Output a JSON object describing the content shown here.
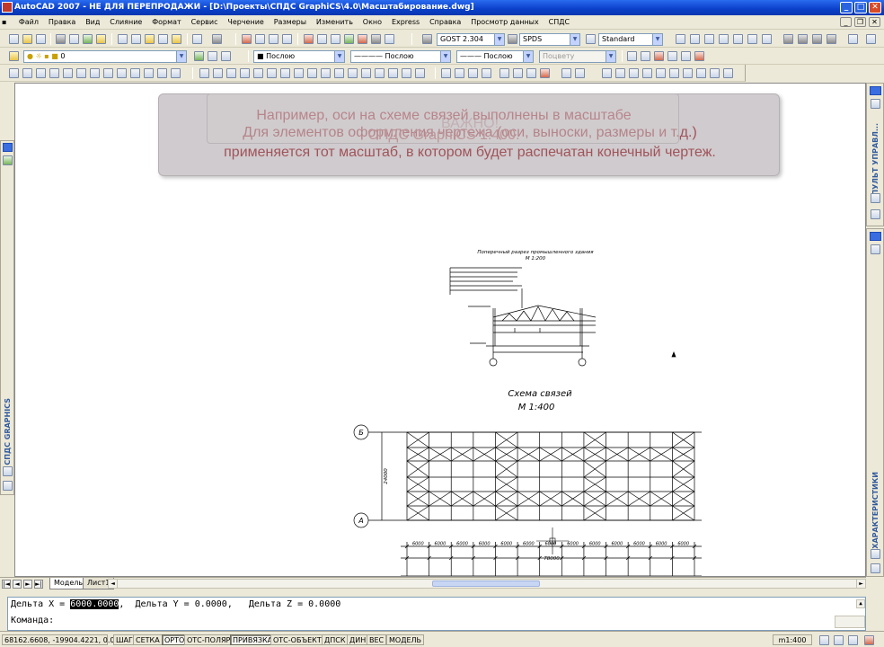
{
  "window": {
    "title": "AutoCAD 2007 - НЕ ДЛЯ ПЕРЕПРОДАЖИ - [D:\\Проекты\\СПДС GraphiCS\\4.0\\Масштабирование.dwg]"
  },
  "menu": [
    "Файл",
    "Правка",
    "Вид",
    "Слияние",
    "Формат",
    "Сервис",
    "Черчение",
    "Размеры",
    "Изменить",
    "Окно",
    "Express",
    "Справка",
    "Просмотр данных",
    "СПДС"
  ],
  "toolbar": {
    "textstyle": "GOST 2.304",
    "dimstyle": "SPDS",
    "tablestyle": "Standard",
    "layer": "0",
    "color": "Послою",
    "linetype": "Послою",
    "lineweight": "Послою",
    "plotstyle": "Поцвету"
  },
  "overlay": {
    "back_title": "ВАЖНО!",
    "back_line1": "Например, оси на схеме связей выполнены в масштабе",
    "back_line2": "СПДС GraphiCS 1:400.",
    "front_line1": "Для элементов оформления чертежа (оси, выноски, размеры и т.д.)",
    "front_line2": "применяется тот масштаб, в котором будет распечатан конечный чертеж."
  },
  "drawing": {
    "section_title": "Поперечный разрез промышленного здания",
    "section_scale": "М 1:200",
    "scheme_title": "Схема связей",
    "scheme_scale": "М 1:400",
    "axis_b": "Б",
    "axis_a": "А",
    "height_dim": "24000",
    "bay_dims": [
      "6000",
      "6000",
      "6000",
      "6000",
      "6000",
      "6000",
      "6000",
      "6000",
      "6000",
      "6000",
      "6000",
      "6000",
      "6000"
    ],
    "total_dim": "78000"
  },
  "panels": {
    "right_top": "ПУЛЬТ УПРАВЛ...",
    "right_bottom": "ХАРАКТЕРИСТИКИ",
    "left": "СПДС GRAPHICS"
  },
  "tabs": [
    "Модель",
    "Лист1"
  ],
  "command": {
    "line1_a": "Дельта X = ",
    "line1_value": "6000.0000",
    "line1_b": ",  Дельта Y = 0.0000,   Дельта Z = 0.0000",
    "prompt": "Команда:"
  },
  "status": {
    "coords": "68162.6608, -19904.4221, 0.0000",
    "buttons": [
      "ШАГ",
      "СЕТКА",
      "ОРТО",
      "ОТС-ПОЛЯР",
      "ПРИВЯЗКА",
      "ОТС-ОБЪЕКТ",
      "ДПСК",
      "ДИН",
      "ВЕС",
      "МОДЕЛЬ"
    ],
    "scale": "m1:400"
  }
}
